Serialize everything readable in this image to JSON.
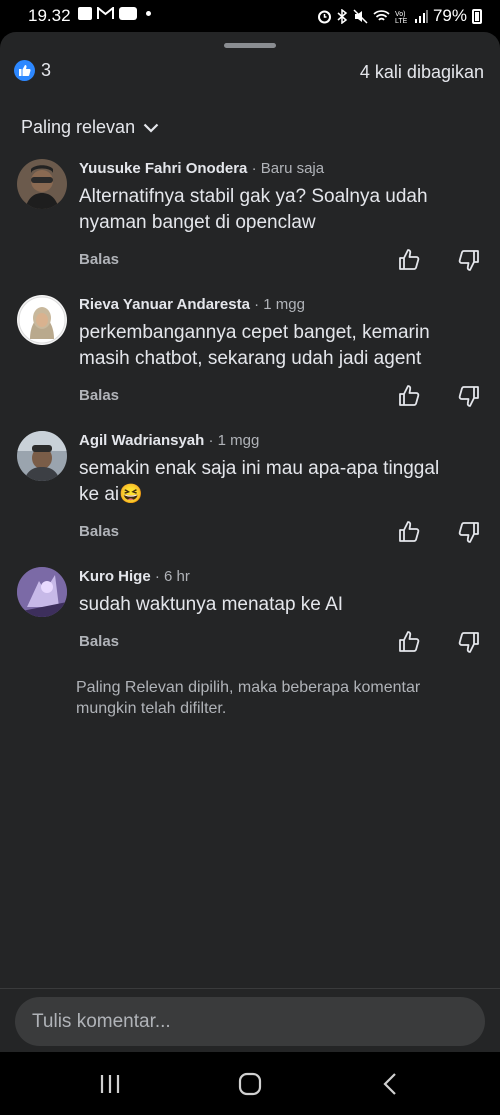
{
  "status_bar": {
    "time": "19.32",
    "battery": "79%",
    "notification_icons": [
      "gallery-icon",
      "gmail-icon",
      "youtube-icon",
      "dot-icon"
    ],
    "system_icons": [
      "alarm-icon",
      "bluetooth-icon",
      "mute-icon",
      "wifi-icon",
      "volte-icon",
      "signal-icon",
      "battery-icon"
    ]
  },
  "post": {
    "reaction_count": "3",
    "shares": "4 kali dibagikan"
  },
  "sort": {
    "label": "Paling relevan"
  },
  "comments": [
    {
      "author": "Yuusuke Fahri Onodera",
      "time": "· Baru saja",
      "lines": [
        "Alternatifnya stabil gak ya? Soalnya udah",
        "nyaman banget di openclaw"
      ],
      "reply": "Balas"
    },
    {
      "author": "Rieva Yanuar Andaresta",
      "time": "· 1 mgg",
      "lines": [
        "perkembangannya cepet banget, kemarin",
        "masih chatbot, sekarang udah jadi agent"
      ],
      "reply": "Balas"
    },
    {
      "author": "Agil Wadriansyah",
      "time": "· 1 mgg",
      "lines": [
        "semakin enak saja ini mau apa-apa tinggal",
        "ke ai😆"
      ],
      "reply": "Balas"
    },
    {
      "author": "Kuro Hige",
      "time": "· 6 hr",
      "lines": [
        "sudah waktunya menatap ke AI"
      ],
      "reply": "Balas"
    }
  ],
  "filter_note": "Paling Relevan dipilih, maka beberapa komentar mungkin telah difilter.",
  "composer": {
    "placeholder": "Tulis komentar..."
  },
  "colors": {
    "sheet": "#242526",
    "accent_blue": "#2d88ff",
    "muted_text": "#b0b3b8"
  }
}
